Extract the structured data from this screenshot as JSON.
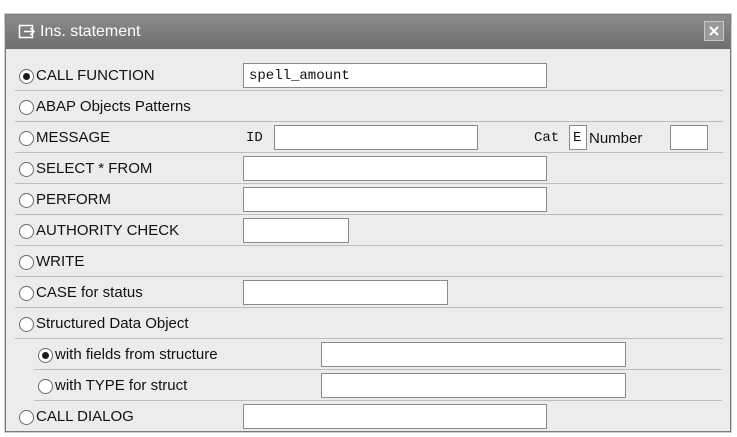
{
  "dialog": {
    "title": "Ins. statement",
    "icons": {
      "title": "insert-statement-icon",
      "close": "close-icon"
    }
  },
  "options": {
    "call_function": {
      "label": "CALL FUNCTION",
      "selected": true,
      "value": "spell_amount"
    },
    "abap_objects": {
      "label": "ABAP Objects Patterns",
      "selected": false
    },
    "message": {
      "label": "MESSAGE",
      "selected": false,
      "id_label": "ID",
      "id_value": "",
      "cat_label": "Cat",
      "cat_value": "E",
      "number_label": "Number",
      "number_value": ""
    },
    "select_from": {
      "label": "SELECT * FROM",
      "selected": false,
      "value": ""
    },
    "perform": {
      "label": "PERFORM",
      "selected": false,
      "value": ""
    },
    "authority_check": {
      "label": "AUTHORITY CHECK",
      "selected": false,
      "value": ""
    },
    "write": {
      "label": "WRITE",
      "selected": false
    },
    "case_status": {
      "label": "CASE for status",
      "selected": false,
      "value": ""
    },
    "structured": {
      "label": "Structured Data Object",
      "selected": false
    },
    "with_fields": {
      "label": "with fields from structure",
      "selected": true,
      "value": ""
    },
    "with_type": {
      "label": "with TYPE for struct",
      "selected": false,
      "value": ""
    },
    "call_dialog": {
      "label": "CALL DIALOG",
      "selected": false,
      "value": ""
    }
  }
}
